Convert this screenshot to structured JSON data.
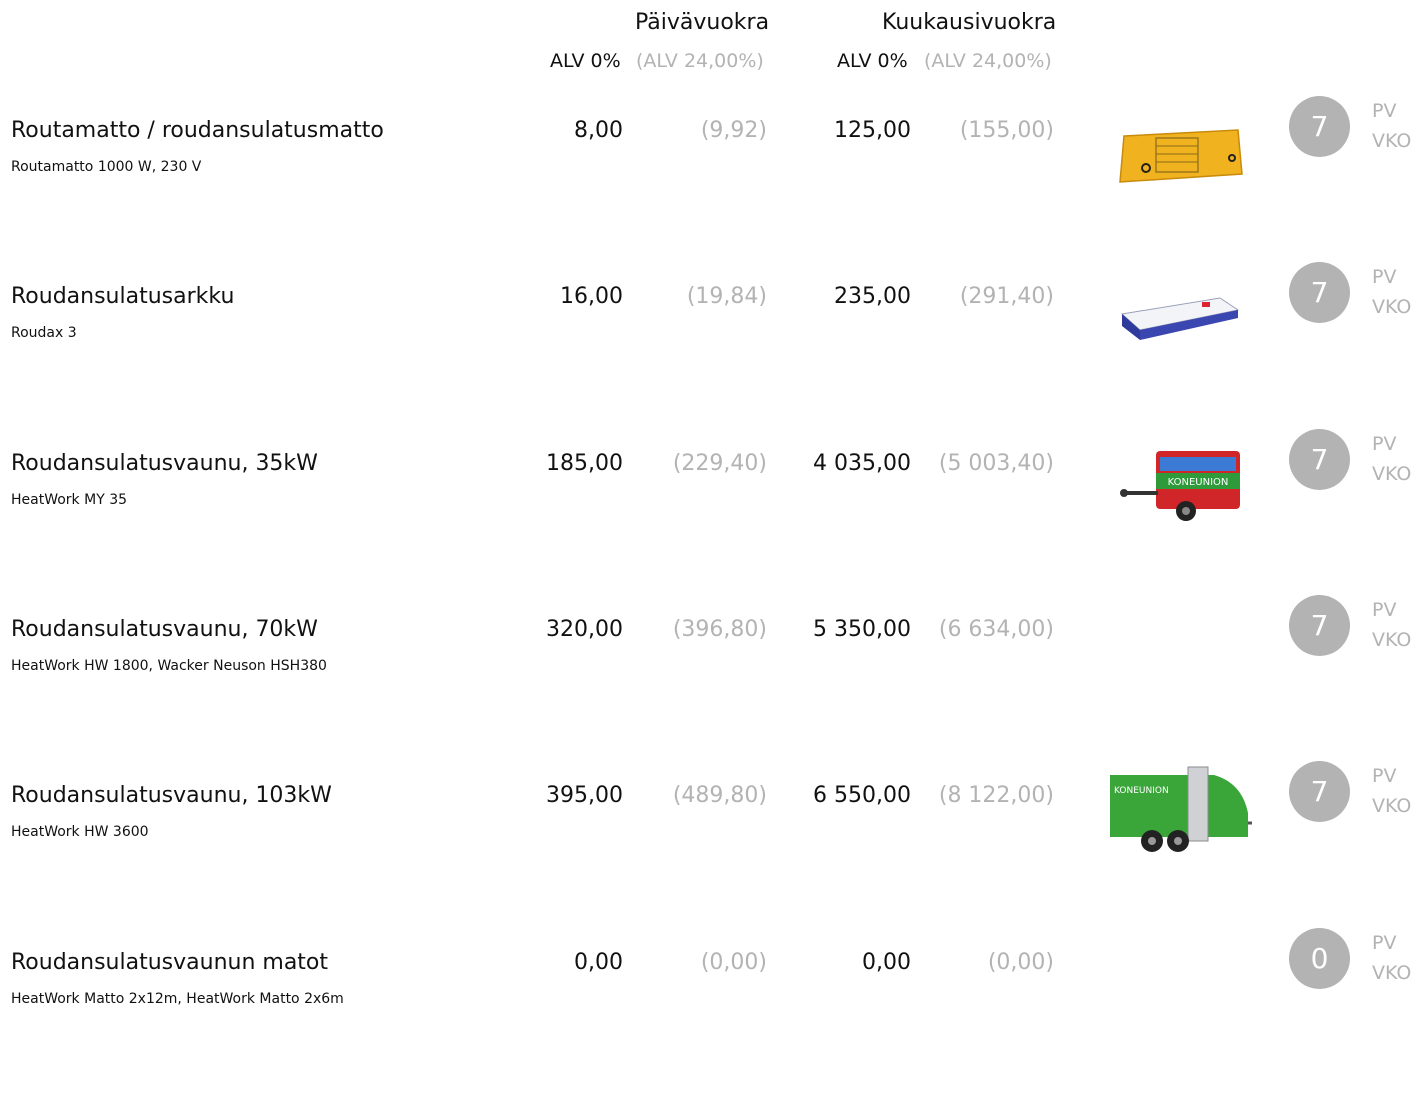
{
  "header": {
    "daily_title": "Päivävuokra",
    "monthly_title": "Kuukausivuokra",
    "vat_excl_label": "ALV 0%",
    "vat_incl_label": "(ALV 24,00%)"
  },
  "rows": [
    {
      "name": "Routamatto / roudansulatusmatto",
      "subtitle": "Routamatto 1000 W, 230 V",
      "daily": "8,00",
      "daily_vat": "(9,92)",
      "monthly": "125,00",
      "monthly_vat": "(155,00)",
      "count": "7",
      "unit_a": "PV",
      "unit_b": "VKO",
      "image": "yellow-heating-mat"
    },
    {
      "name": "Roudansulatusarkku",
      "subtitle": "Roudax 3",
      "daily": "16,00",
      "daily_vat": "(19,84)",
      "monthly": "235,00",
      "monthly_vat": "(291,40)",
      "count": "7",
      "unit_a": "PV",
      "unit_b": "VKO",
      "image": "white-thaw-box"
    },
    {
      "name": "Roudansulatusvaunu, 35kW",
      "subtitle": "HeatWork MY 35",
      "daily": "185,00",
      "daily_vat": "(229,40)",
      "monthly": "4 035,00",
      "monthly_vat": "(5 003,40)",
      "count": "7",
      "unit_a": "PV",
      "unit_b": "VKO",
      "image": "red-trailer",
      "image_text": "KONEUNION"
    },
    {
      "name": "Roudansulatusvaunu, 70kW",
      "subtitle": "HeatWork HW 1800, Wacker Neuson HSH380",
      "daily": "320,00",
      "daily_vat": "(396,80)",
      "monthly": "5 350,00",
      "monthly_vat": "(6 634,00)",
      "count": "7",
      "unit_a": "PV",
      "unit_b": "VKO",
      "image": ""
    },
    {
      "name": "Roudansulatusvaunu, 103kW",
      "subtitle": "HeatWork HW 3600",
      "daily": "395,00",
      "daily_vat": "(489,80)",
      "monthly": "6 550,00",
      "monthly_vat": "(8 122,00)",
      "count": "7",
      "unit_a": "PV",
      "unit_b": "VKO",
      "image": "green-trailer",
      "image_text": "KONEUNION"
    },
    {
      "name": "Roudansulatusvaunun matot",
      "subtitle": "HeatWork Matto 2x12m, HeatWork Matto 2x6m",
      "daily": "0,00",
      "daily_vat": "(0,00)",
      "monthly": "0,00",
      "monthly_vat": "(0,00)",
      "count": "0",
      "unit_a": "PV",
      "unit_b": "VKO",
      "image": ""
    }
  ]
}
